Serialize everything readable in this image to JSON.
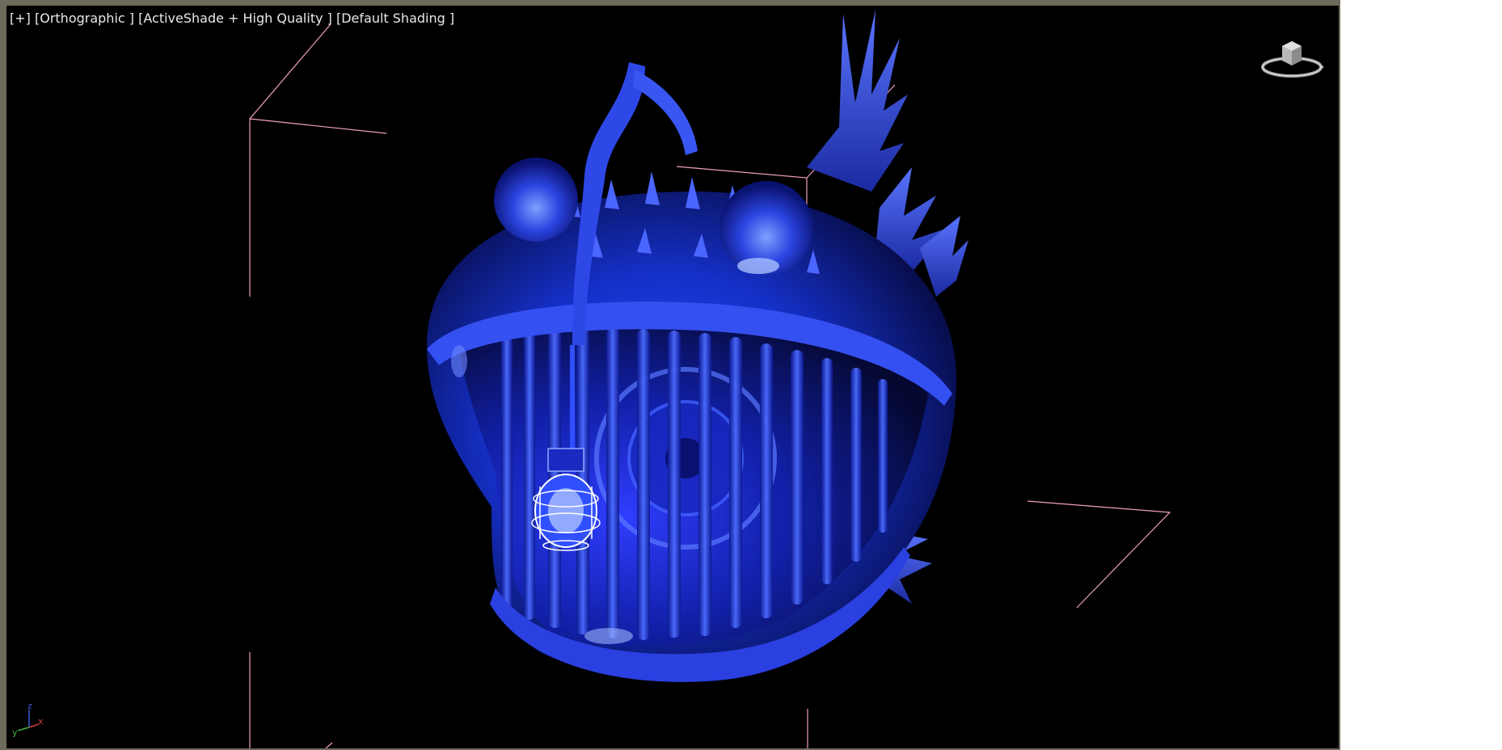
{
  "viewport": {
    "menu_plus": "[+]",
    "view_mode": "[Orthographic ]",
    "render_mode": "[ActiveShade + High Quality ]",
    "shading_mode": "[Default Shading ]"
  },
  "viewcube": {
    "icon": "viewcube-icon"
  },
  "axis_tripod": {
    "x_label": "x",
    "y_label": "y",
    "z_label": "z",
    "x_color": "#d23c3c",
    "y_color": "#3cb43c",
    "z_color": "#3c5ad2"
  },
  "colors": {
    "frame": "#6e6a5c",
    "viewport_bg": "#000000",
    "selection_bbox": "#f0a0c0",
    "model_blue": "#1a2cff"
  }
}
